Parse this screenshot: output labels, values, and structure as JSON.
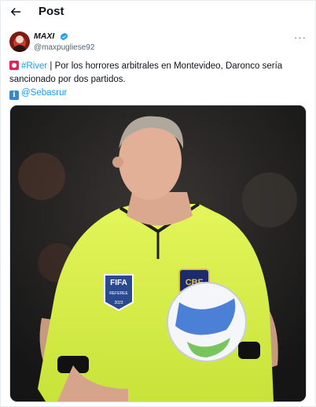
{
  "header": {
    "title": "Post",
    "back_icon": "arrow-left-icon"
  },
  "author": {
    "name": "MAXI",
    "handle": "@maxpugliese92",
    "verified": true,
    "avatar_icon": "avatar"
  },
  "tweet": {
    "line1_prefix_icon": "red-badge-emoji",
    "hashtag": "#River",
    "text": " | Por los horrores arbitrales en Montevideo, Daronco sería sancionado por dos partidos.",
    "info_icon": "info-emoji",
    "mention": "@Sebasrur"
  },
  "media": {
    "alt": "Referee in neon yellow shirt holding a match ball",
    "badges": {
      "fifa": "FIFA",
      "referee": "REFEREE",
      "year": "2023",
      "cbf": "CBF"
    }
  },
  "more_icon": "more-options-icon",
  "colors": {
    "link": "#1d9bf0",
    "jersey": "#d7f24a",
    "background": "#ffffff"
  }
}
